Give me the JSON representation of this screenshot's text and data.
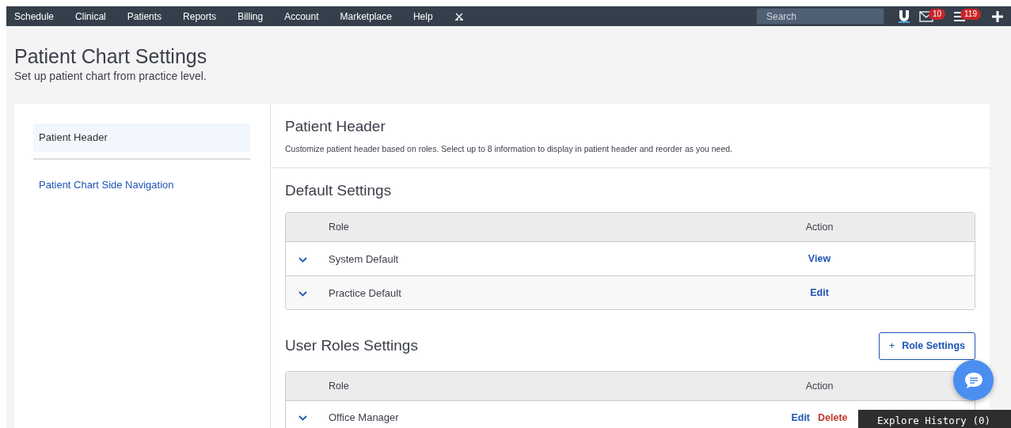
{
  "topnav": {
    "items": [
      {
        "label": "Schedule"
      },
      {
        "label": "Clinical"
      },
      {
        "label": "Patients"
      },
      {
        "label": "Reports"
      },
      {
        "label": "Billing"
      },
      {
        "label": "Account"
      },
      {
        "label": "Marketplace"
      },
      {
        "label": "Help"
      }
    ],
    "search": {
      "placeholder": "Search"
    },
    "messages_badge": "10",
    "tasks_badge": "119"
  },
  "page": {
    "title": "Patient Chart Settings",
    "subtitle": "Set up patient chart from practice level."
  },
  "sidebar": {
    "items": [
      {
        "label": "Patient Header",
        "selected": true
      },
      {
        "label": "Patient Chart Side Navigation",
        "selected": false
      }
    ]
  },
  "content": {
    "title": "Patient Header",
    "description": "Customize patient header based on roles. Select up to 8 information to display in patient header and reorder as you need.",
    "sections": [
      {
        "title": "Default Settings",
        "columns": [
          "Role",
          "Action"
        ],
        "rows": [
          {
            "role": "System Default",
            "actions": [
              {
                "label": "View",
                "kind": "primary"
              }
            ]
          },
          {
            "role": "Practice Default",
            "actions": [
              {
                "label": "Edit",
                "kind": "primary"
              }
            ]
          }
        ]
      },
      {
        "title": "User Roles Settings",
        "button_icon": "+",
        "button": "Role Settings",
        "columns": [
          "Role",
          "Action"
        ],
        "rows": [
          {
            "role": "Office Manager",
            "actions": [
              {
                "label": "Edit",
                "kind": "primary"
              },
              {
                "label": "Delete",
                "kind": "danger"
              }
            ]
          }
        ]
      }
    ]
  },
  "explore_history": "Explore History (0)"
}
